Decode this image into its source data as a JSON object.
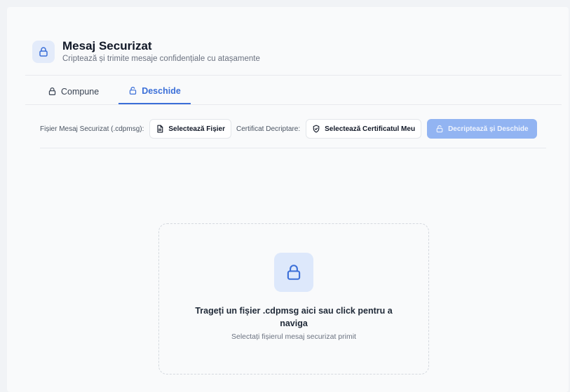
{
  "header": {
    "title": "Mesaj Securizat",
    "subtitle": "Criptează și trimite mesaje confidențiale cu atașamente",
    "icon": "lock-icon"
  },
  "tabs": [
    {
      "label": "Compune",
      "icon": "lock-icon",
      "active": false
    },
    {
      "label": "Deschide",
      "icon": "unlock-icon",
      "active": true
    }
  ],
  "toolbar": {
    "file_label": "Fișier Mesaj Securizat (.cdpmsg):",
    "file_button": "Selectează Fișier",
    "cert_label": "Certificat Decriptare:",
    "cert_button": "Selectează Certificatul Meu",
    "decrypt_button": "Decriptează și Deschide"
  },
  "dropzone": {
    "title": "Trageți un fișier .cdpmsg aici sau click pentru a naviga",
    "subtitle": "Selectați fișierul mesaj securizat primit",
    "icon": "lock-icon"
  },
  "colors": {
    "accent": "#3b6fd8",
    "primary_disabled": "#92b4f2",
    "icon_bg": "#e3ebfa"
  }
}
